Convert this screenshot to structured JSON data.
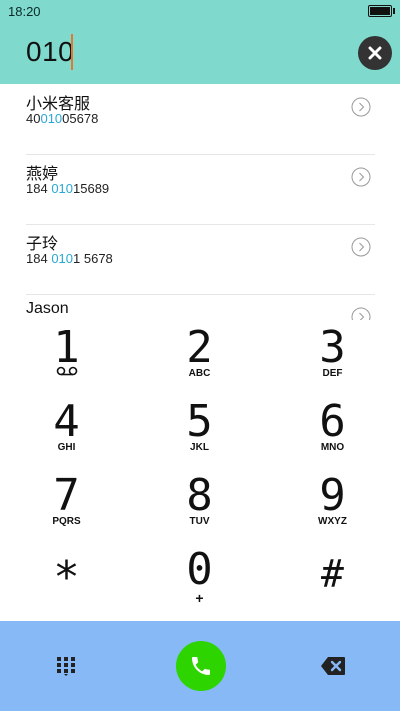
{
  "status": {
    "time": "18:20"
  },
  "search": {
    "entry": "010"
  },
  "contacts": [
    {
      "name": "小米客服",
      "num_pre": "40",
      "num_hl": "010",
      "num_post": "05678"
    },
    {
      "name": "燕婷",
      "num_pre": "184 ",
      "num_hl": "010",
      "num_post": "15689"
    },
    {
      "name": "子玲",
      "num_pre": "184 ",
      "num_hl": "010",
      "num_post": "1 5678"
    },
    {
      "name": "Jason",
      "num_pre": "",
      "num_hl": "",
      "num_post": ""
    }
  ],
  "keypad": [
    {
      "digit": "1",
      "letters": ""
    },
    {
      "digit": "2",
      "letters": "ABC"
    },
    {
      "digit": "3",
      "letters": "DEF"
    },
    {
      "digit": "4",
      "letters": "GHI"
    },
    {
      "digit": "5",
      "letters": "JKL"
    },
    {
      "digit": "6",
      "letters": "MNO"
    },
    {
      "digit": "7",
      "letters": "PQRS"
    },
    {
      "digit": "8",
      "letters": "TUV"
    },
    {
      "digit": "9",
      "letters": "WXYZ"
    },
    {
      "digit": "*",
      "letters": ""
    },
    {
      "digit": "0",
      "letters": "+"
    },
    {
      "digit": "#",
      "letters": ""
    }
  ],
  "icons": {
    "clear": "clear-icon",
    "detail": "chevron-right-circle-icon",
    "voicemail": "voicemail-icon",
    "dialpad": "dialpad-icon",
    "call": "phone-icon",
    "backspace": "backspace-icon"
  },
  "colors": {
    "header": "#7fd9cc",
    "highlight": "#2aa7d8",
    "call": "#2dd400",
    "bottom_bar": "#86b9f5"
  }
}
